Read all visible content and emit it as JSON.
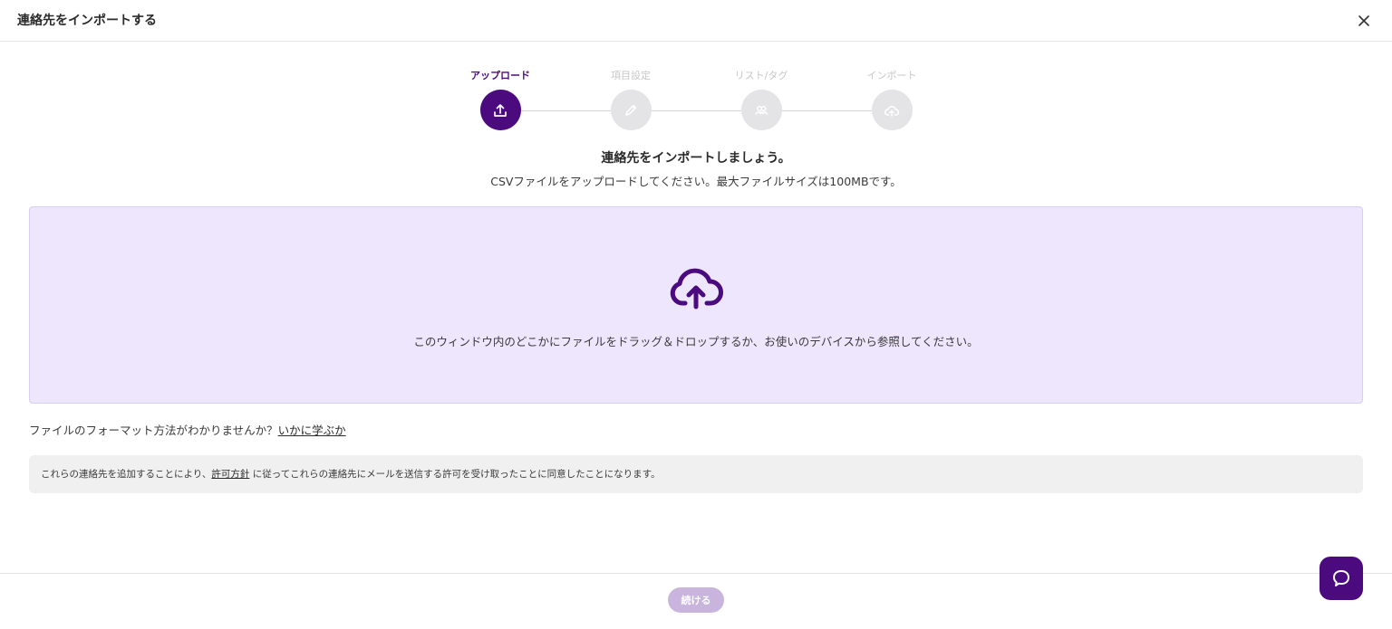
{
  "header": {
    "title": "連絡先をインポートする",
    "close_icon": "close-icon"
  },
  "stepper": {
    "steps": [
      {
        "label": "アップロード",
        "icon": "upload-icon",
        "active": true
      },
      {
        "label": "項目設定",
        "icon": "pencil-icon",
        "active": false
      },
      {
        "label": "リスト/タグ",
        "icon": "people-icon",
        "active": false
      },
      {
        "label": "インポート",
        "icon": "cloud-upload-icon",
        "active": false
      }
    ]
  },
  "main": {
    "heading": "連絡先をインポートしましょう。",
    "subheading": "CSVファイルをアップロードしてください。最大ファイルサイズは100MBです。"
  },
  "dropzone": {
    "icon": "cloud-upload-icon",
    "text": "このウィンドウ内のどこかにファイルをドラッグ＆ドロップするか、お使いのデバイスから参照してください。"
  },
  "help": {
    "text": "ファイルのフォーマット方法がわかりませんか？",
    "link": "いかに学ぶか"
  },
  "notice": {
    "before": "これらの連絡先を追加することにより、",
    "link": "許可方針",
    "after": " に従ってこれらの連絡先にメールを送信する許可を受け取ったことに同意したことになります。"
  },
  "footer": {
    "continue_label": "続ける"
  },
  "colors": {
    "accent": "#4b0a7e",
    "dropzone_bg": "#ede6fd",
    "button_disabled": "#c8b4dd"
  },
  "chat": {
    "icon": "chat-icon"
  }
}
